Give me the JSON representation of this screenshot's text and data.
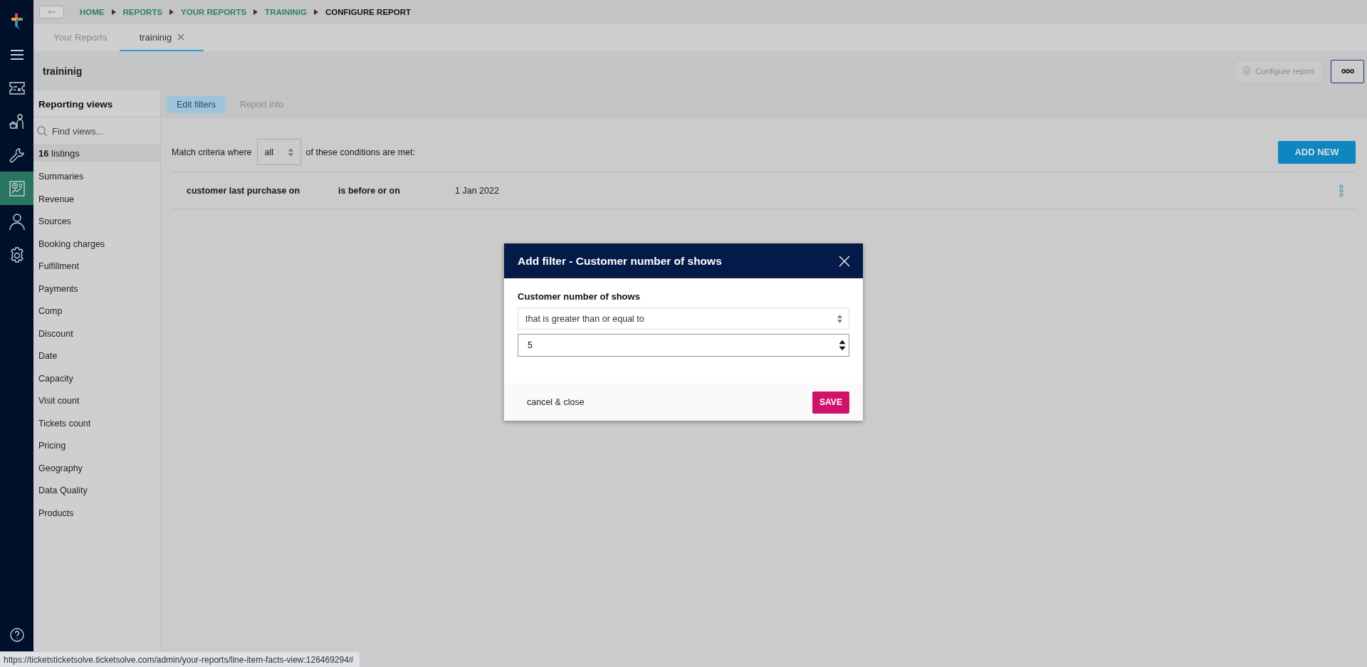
{
  "rail": [
    {
      "kind": "logo",
      "selected": false
    },
    {
      "kind": "menu",
      "selected": false
    },
    {
      "kind": "ticket",
      "selected": false
    },
    {
      "kind": "people",
      "selected": false
    },
    {
      "kind": "wrench",
      "selected": false
    },
    {
      "kind": "report",
      "selected": true
    },
    {
      "kind": "user",
      "selected": false
    },
    {
      "kind": "settings",
      "selected": false
    },
    {
      "kind": "help",
      "selected": false
    }
  ],
  "breadcrumb": [
    {
      "label": "HOME",
      "current": false
    },
    {
      "label": "REPORTS",
      "current": false
    },
    {
      "label": "YOUR REPORTS",
      "current": false
    },
    {
      "label": "TRAININIG",
      "current": false
    },
    {
      "label": "CONFIGURE REPORT",
      "current": true
    }
  ],
  "tabs": [
    {
      "label": "Your Reports",
      "selected": false,
      "closable": false
    },
    {
      "label": "traininig",
      "selected": true,
      "closable": true
    }
  ],
  "report_title": "traininig",
  "configure_button": "Configure report",
  "sidebar": {
    "title": "Reporting views",
    "search_placeholder": "Find views...",
    "listings": "**16** listings",
    "items": [
      "Summaries",
      "Revenue",
      "Sources",
      "Booking charges",
      "Fulfillment",
      "Payments",
      "Comp",
      "Discount",
      "Date",
      "Capacity",
      "Visit count",
      "Tickets count",
      "Pricing",
      "Geography",
      "Data Quality",
      "Products"
    ]
  },
  "view_tabs": [
    {
      "label": "Edit filters",
      "selected": true
    },
    {
      "label": "Report info",
      "selected": false
    }
  ],
  "match": {
    "prefix": "Match criteria where",
    "value": "all",
    "suffix": "of these conditions are met:"
  },
  "add_button": "ADD NEW",
  "filters": [
    {
      "field": "customer last purchase on",
      "operator": "is before or on",
      "value": "1 Jan 2022"
    }
  ],
  "modal": {
    "title": "Add filter - Customer number of shows",
    "label": "Customer number of shows",
    "operator": "that is greater than or equal to",
    "value": "5",
    "cancel": "cancel & close",
    "save": "SAVE"
  },
  "status_url": "https://ticketsticketsolve.ticketsolve.com/admin/your-reports/line-item-facts-view:126469294#"
}
